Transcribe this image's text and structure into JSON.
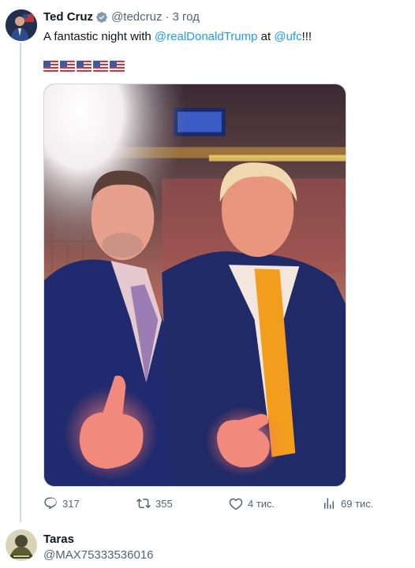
{
  "tweet": {
    "author_name": "Ted Cruz",
    "handle": "@tedcruz",
    "separator": "·",
    "time": "3 год",
    "text_prefix": "A fantastic night with ",
    "mention_1": "@realDonaldTrump",
    "text_middle": " at ",
    "mention_2": "@ufc",
    "text_suffix": "!!!",
    "flag_count": 5,
    "flag_colors": {
      "red": "#d8333a",
      "white": "#ffffff",
      "blue": "#3c5aa6"
    },
    "media_alt": "Photo at UFC event",
    "actions": {
      "replies": "317",
      "retweets": "355",
      "likes": "4 тис.",
      "views": "69 тис."
    }
  },
  "reply": {
    "author_name": "Taras",
    "handle": "@MAX75333536016"
  },
  "colors": {
    "link": "#1d9bf0",
    "secondary_text": "#536471",
    "verified": "#829aab",
    "thread_line": "#cfd9de"
  },
  "icons": {
    "verified": "verified-badge-icon",
    "reply": "reply-icon",
    "retweet": "retweet-icon",
    "like": "heart-icon",
    "views": "views-bar-chart-icon"
  }
}
